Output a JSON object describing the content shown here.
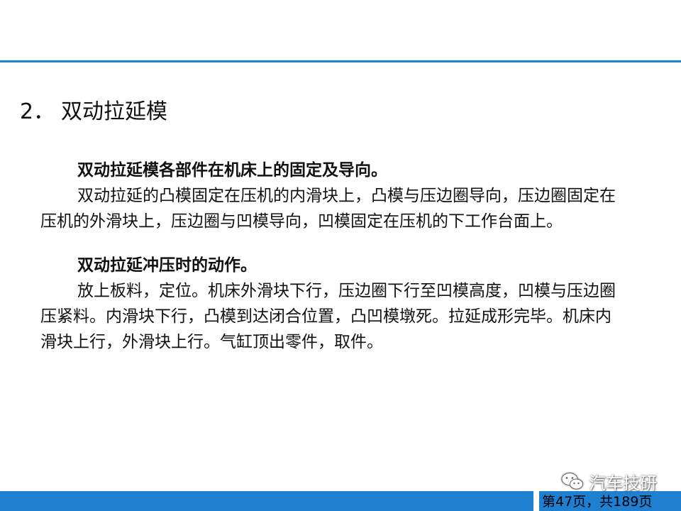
{
  "slide": {
    "section_number": "2．",
    "section_title": "双动拉延模",
    "heading_1": "双动拉延模各部件在机床上的固定及导向。",
    "paragraph_1": "双动拉延的凸模固定在压机的内滑块上，凸模与压边圈导向，压边圈固定在压机的外滑块上，压边圈与凹模导向，凹模固定在压机的下工作台面上。",
    "heading_2": "双动拉延冲压时的动作。",
    "paragraph_2": "放上板料，定位。机床外滑块下行，压边圈下行至凹模高度，凹模与压边圈压紧料。内滑块下行，凸模到达闭合位置，凸凹模墩死。拉延成形完毕。机床内滑块上行，外滑块上行。气缸顶出零件，取件。"
  },
  "footer": {
    "page_label": "第47页，共189页",
    "watermark_text": "汽车技研",
    "watermark_icon": "wechat-icon"
  },
  "colors": {
    "accent_blue": "#1f7fd0",
    "text": "#111111"
  }
}
